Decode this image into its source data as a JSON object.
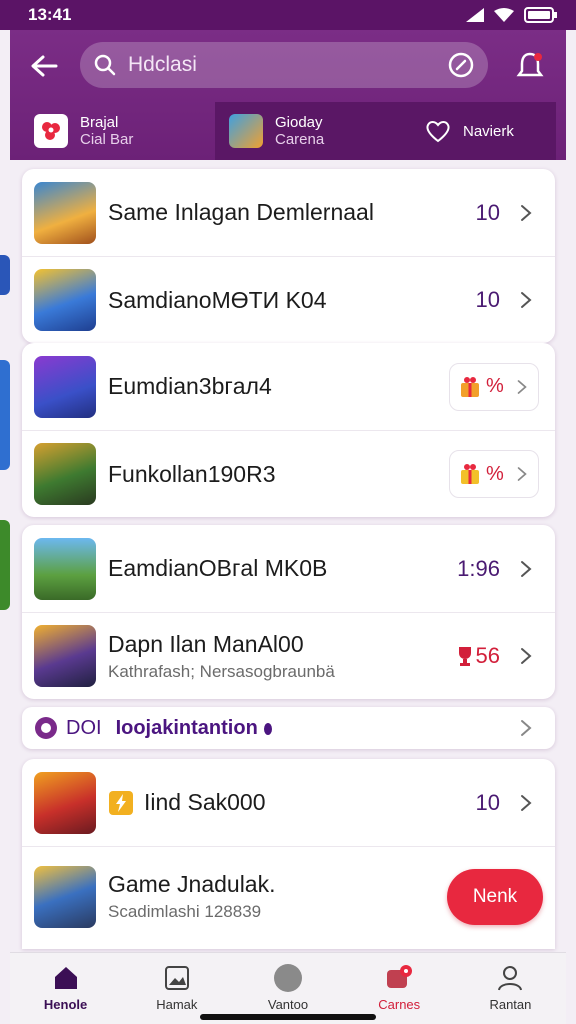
{
  "status_bar": {
    "time": "13:41"
  },
  "header": {
    "search": {
      "query": "Hdclasi"
    },
    "tabs": [
      {
        "line1": "Brajal",
        "line2": "Cial Bar"
      },
      {
        "line1": "Gioday",
        "line2": "Carena"
      },
      {
        "line1": "Navierk"
      }
    ]
  },
  "groups": [
    {
      "items": [
        {
          "title": "Same Inlagan Demlernaal",
          "value": "10"
        },
        {
          "title": "SamdianоMӨTИ K04",
          "value": "10"
        }
      ]
    },
    {
      "items": [
        {
          "title": "Eumdian3bгaл4",
          "value": "%"
        },
        {
          "title": "Funkollan190R3",
          "value": "%"
        }
      ]
    },
    {
      "items": [
        {
          "title": "EamdianОBгal MK0B",
          "value": "1:96"
        },
        {
          "title": "Dapn Ilan ManAl00",
          "subtitle": "Kathrafash; Nersasogbraunbä",
          "value": "56"
        }
      ]
    }
  ],
  "strip": {
    "label_prefix": "DOI",
    "label": "Ioojakintantion"
  },
  "group4": {
    "items": [
      {
        "title": "Iind Sak000",
        "value": "10"
      },
      {
        "title": "Game Jnadulak.",
        "subtitle": "Scadimlashi 128839",
        "button": "Nenk"
      }
    ]
  },
  "bottom_nav": [
    {
      "label": "Henole",
      "icon": "home-icon"
    },
    {
      "label": "Hamak",
      "icon": "gallery-icon"
    },
    {
      "label": "Vantoo",
      "icon": "circle-icon"
    },
    {
      "label": "Carnes",
      "icon": "games-icon"
    },
    {
      "label": "Rantan",
      "icon": "profile-icon"
    }
  ],
  "colors": {
    "primary": "#6c2177",
    "accent_red": "#d21f3a",
    "value_purple": "#4a1a72"
  }
}
